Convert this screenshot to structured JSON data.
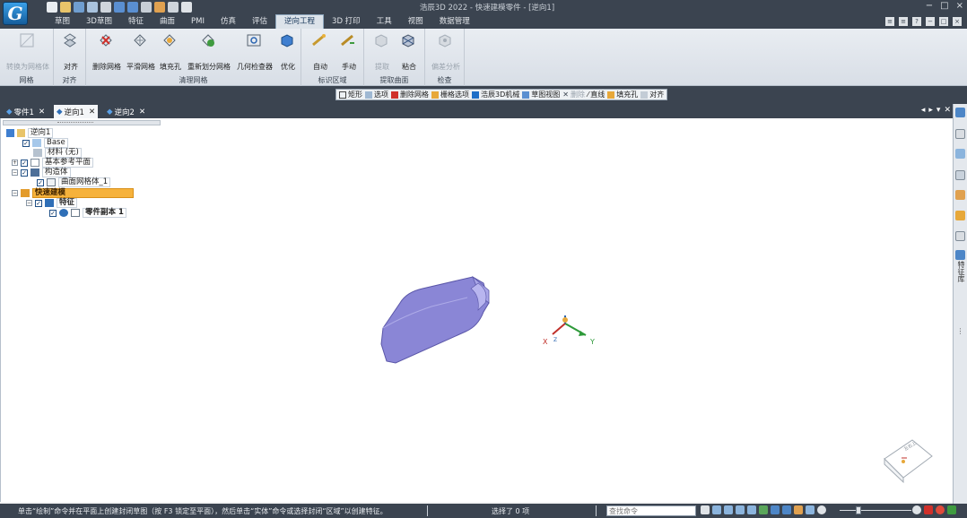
{
  "app": {
    "logo_letter": "G",
    "title": "浩辰3D 2022 - 快速建模零件 - [逆向1]",
    "window_controls": [
      "−",
      "□",
      "×"
    ]
  },
  "menu": {
    "tabs": [
      {
        "label": "草图",
        "active": false
      },
      {
        "label": "3D草图",
        "active": false
      },
      {
        "label": "特征",
        "active": false
      },
      {
        "label": "曲面",
        "active": false
      },
      {
        "label": "PMI",
        "active": false
      },
      {
        "label": "仿真",
        "active": false
      },
      {
        "label": "评估",
        "active": false
      },
      {
        "label": "逆向工程",
        "active": true
      },
      {
        "label": "3D 打印",
        "active": false
      },
      {
        "label": "工具",
        "active": false
      },
      {
        "label": "视图",
        "active": false
      },
      {
        "label": "数据管理",
        "active": false
      }
    ]
  },
  "ribbon": {
    "groups": [
      {
        "label": "网格",
        "buttons": [
          {
            "label": "转换为网格体",
            "disabled": true
          }
        ]
      },
      {
        "label": "对齐",
        "buttons": [
          {
            "label": "对齐",
            "disabled": false
          }
        ]
      },
      {
        "label": "清理网格",
        "buttons": [
          {
            "label": "删除网格",
            "disabled": false
          },
          {
            "label": "平滑网格",
            "disabled": false
          },
          {
            "label": "填充孔",
            "disabled": false
          },
          {
            "label": "重新划分网格",
            "disabled": false
          },
          {
            "label": "几何检查器",
            "disabled": false
          },
          {
            "label": "优化",
            "disabled": false
          }
        ]
      },
      {
        "label": "标识区域",
        "buttons": [
          {
            "label": "自动",
            "disabled": false
          },
          {
            "label": "手动",
            "disabled": false
          }
        ]
      },
      {
        "label": "提取曲面",
        "buttons": [
          {
            "label": "提取",
            "disabled": true
          },
          {
            "label": "粘合",
            "disabled": false
          }
        ]
      },
      {
        "label": "检查",
        "buttons": [
          {
            "label": "偏差分析",
            "disabled": true
          }
        ]
      }
    ]
  },
  "lowtools": {
    "items": [
      {
        "label": "矩形",
        "disabled": false
      },
      {
        "label": "选项",
        "disabled": false
      },
      {
        "label": "删除网格",
        "disabled": false
      },
      {
        "label": "栅格选项",
        "disabled": false
      },
      {
        "label": "浩辰3D机械",
        "disabled": false
      },
      {
        "label": "草图视图",
        "disabled": false
      },
      {
        "label": "删除",
        "disabled": true
      },
      {
        "label": "直线",
        "disabled": false
      },
      {
        "label": "填充孔",
        "disabled": false
      },
      {
        "label": "对齐",
        "disabled": false
      }
    ]
  },
  "doc_tabs": [
    {
      "label": "零件1",
      "active": false
    },
    {
      "label": "逆向1",
      "active": true
    },
    {
      "label": "逆向2",
      "active": false
    }
  ],
  "tree": {
    "root": "逆向1",
    "base": "Base",
    "material": "材料 (无)",
    "ref_planes": "基本参考平面",
    "construction": "构造体",
    "mesh_body": "曲面网格体_1",
    "rapid_model": "快速建模",
    "features": "特征",
    "part_copy": "零件副本 1"
  },
  "triad": {
    "x": "X",
    "y": "Y",
    "z": "Z"
  },
  "view_cube": {
    "label": "左右上"
  },
  "dock": {
    "tab_text": "特征库"
  },
  "status": {
    "message": "单击“绘制”命令并在平面上创建封闭草图（按 F3 锁定至平面），然后单击“实体”命令或选择封闭“区域”以创建特征。",
    "selection": "选择了 0 项",
    "search_placeholder": "查找命令"
  },
  "colors": {
    "chrome": "#3b4450",
    "ribbon_bg": "#e3e8ee",
    "highlight": "#f6b23c",
    "model_fill": "#8a86d6"
  }
}
